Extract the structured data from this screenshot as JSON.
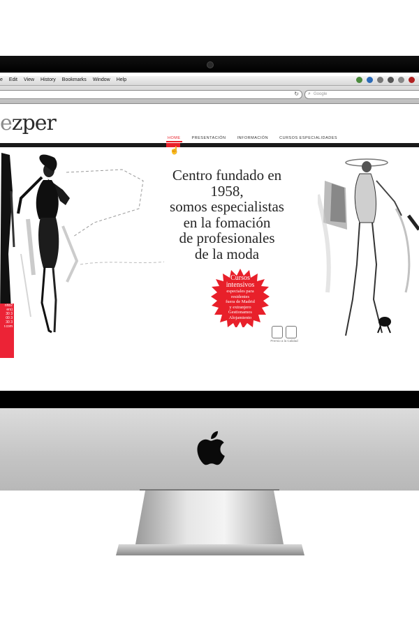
{
  "browser": {
    "menu_items": [
      "e",
      "Edit",
      "View",
      "History",
      "Bookmarks",
      "Window",
      "Help"
    ],
    "search_placeholder": "Google"
  },
  "site": {
    "logo_text_dim": "e",
    "logo_text": "zper",
    "nav": [
      {
        "label": "HOME",
        "active": true
      },
      {
        "label": "PRESENTACIÓN",
        "active": false
      },
      {
        "label": "INFORMACIÓN",
        "active": false
      },
      {
        "label": "CURSOS ESPECIALIDADES",
        "active": false
      }
    ],
    "headline": [
      "Centro fundado en",
      "1958,",
      "somos especialistas",
      "en la fomación",
      "de profesionales",
      "de la moda"
    ],
    "badge": {
      "lines": [
        "Cursos",
        "intensivos",
        "especiales para",
        "residentes",
        "fuera de Madrid",
        "y extranjero",
        "Gestionamos",
        "Alojamiento"
      ]
    },
    "award_caption": "Premio a la Calidad",
    "side_box_lines": [
      "nhb2",
      "ers)",
      "30 3",
      "00 3",
      "30 3",
      "r.com"
    ]
  },
  "colors": {
    "accent": "#e8202a",
    "badge": "#e8202a"
  }
}
